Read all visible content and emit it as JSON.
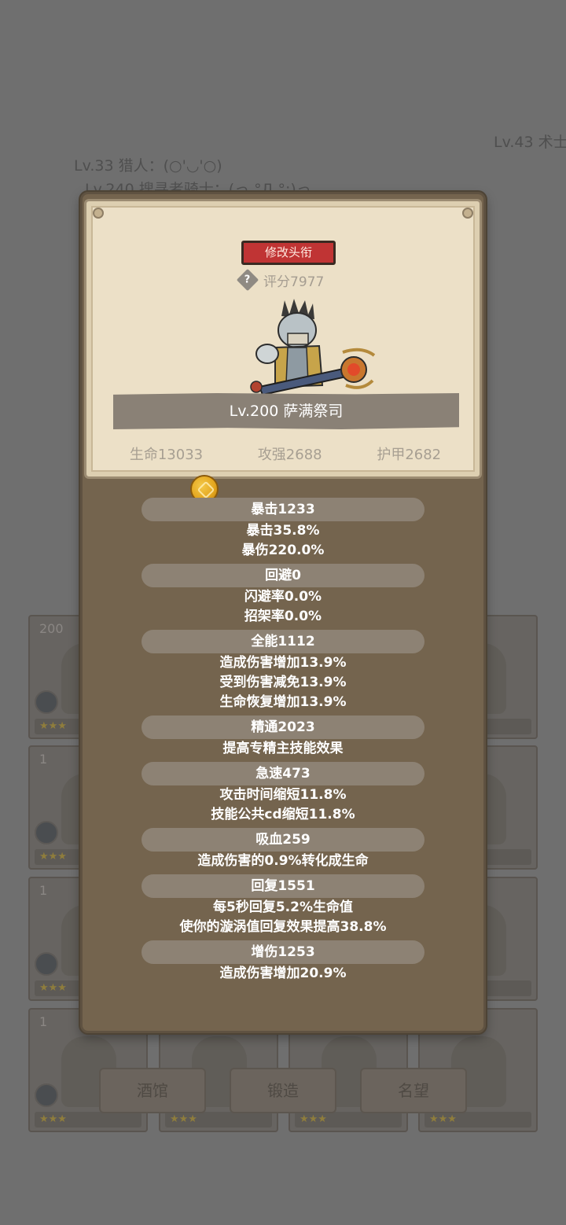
{
  "background": {
    "labels": [
      {
        "text": "Lv.33 猎人：(○'◡'○)"
      },
      {
        "text": "Lv.240 搜寻者骑士：(っ °Д °;)っ"
      },
      {
        "text": "Lv.43 术士"
      }
    ],
    "cards": [
      {
        "count": "200"
      },
      {
        "count": "1"
      },
      {
        "count": "1"
      },
      {
        "count": "1"
      }
    ],
    "buttons": [
      "酒馆",
      "锻造",
      "名望"
    ]
  },
  "popup": {
    "rename_label": "修改头衔",
    "help_symbol": "?",
    "score": "评分7977",
    "hero_name": "Lv.200 萨满祭司",
    "base_stats": [
      "生命13033",
      "攻强2688",
      "护甲2682"
    ],
    "sections": [
      {
        "header": "暴击1233",
        "lines": [
          "暴击35.8%",
          "暴伤220.0%"
        ]
      },
      {
        "header": "回避0",
        "lines": [
          "闪避率0.0%",
          "招架率0.0%"
        ]
      },
      {
        "header": "全能1112",
        "lines": [
          "造成伤害增加13.9%",
          "受到伤害减免13.9%",
          "生命恢复增加13.9%"
        ]
      },
      {
        "header": "精通2023",
        "lines": [
          "提高专精主技能效果"
        ]
      },
      {
        "header": "急速473",
        "lines": [
          "攻击时间缩短11.8%",
          "技能公共cd缩短11.8%"
        ]
      },
      {
        "header": "吸血259",
        "lines": [
          "造成伤害的0.9%转化成生命"
        ]
      },
      {
        "header": "回复1551",
        "lines": [
          "每5秒回复5.2%生命值",
          "使你的漩涡值回复效果提高38.8%"
        ]
      },
      {
        "header": "增伤1253",
        "lines": [
          "造成伤害增加20.9%"
        ]
      }
    ]
  },
  "colors": {
    "rename_button": "#c03434",
    "popup_body": "#74644e",
    "parchment": "#ece0c7",
    "stat_header": "#8d8274"
  }
}
